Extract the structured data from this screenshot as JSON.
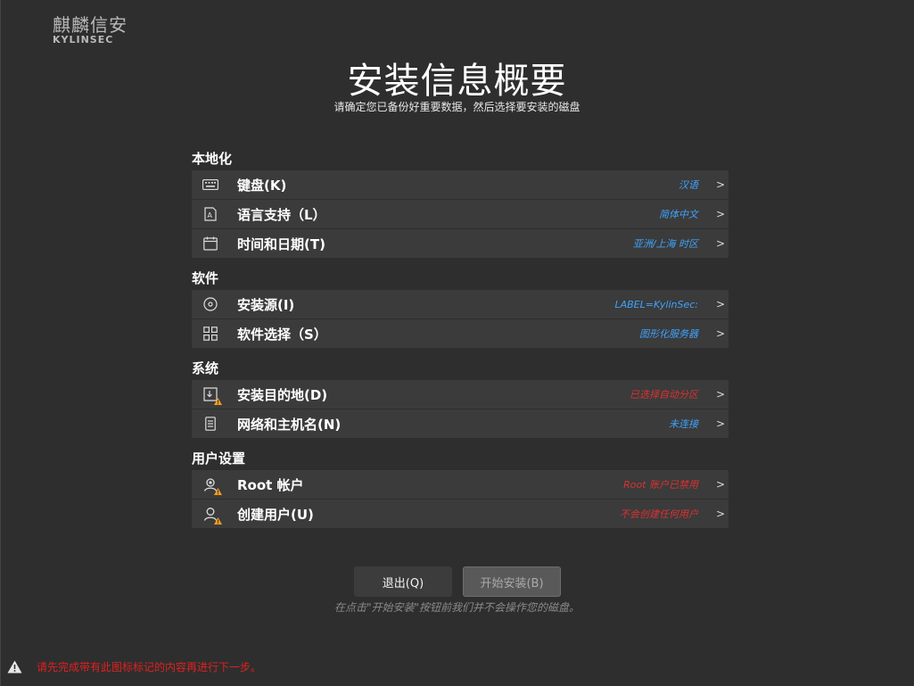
{
  "brand": {
    "name_cn": "麒麟信安",
    "name_en": "KYLINSEC"
  },
  "header": {
    "title": "安装信息概要",
    "subtitle": "请确定您已备份好重要数据，然后选择要安装的磁盘"
  },
  "sections": {
    "localization": {
      "title": "本地化",
      "items": [
        {
          "label": "键盘(K)",
          "status": "汉语",
          "icon": "keyboard-icon"
        },
        {
          "label": "语言支持（L）",
          "status": "简体中文",
          "icon": "language-icon"
        },
        {
          "label": "时间和日期(T)",
          "status": "亚洲/上海 时区",
          "icon": "calendar-icon"
        }
      ]
    },
    "software": {
      "title": "软件",
      "items": [
        {
          "label": "安装源(I)",
          "status": "LABEL=KylinSec:",
          "icon": "disc-icon"
        },
        {
          "label": "软件选择（S）",
          "status": "图形化服务器",
          "icon": "grid-icon"
        }
      ]
    },
    "system": {
      "title": "系统",
      "items": [
        {
          "label": "安装目的地(D)",
          "status": "已选择自动分区",
          "icon": "disk-warning-icon"
        },
        {
          "label": "网络和主机名(N)",
          "status": "未连接",
          "icon": "network-icon"
        }
      ]
    },
    "user": {
      "title": "用户设置",
      "items": [
        {
          "label": "Root 帐户",
          "status": "Root 账户已禁用",
          "icon": "root-user-warning-icon"
        },
        {
          "label": "创建用户(U)",
          "status": "不会创建任何用户",
          "icon": "user-warning-icon"
        }
      ]
    }
  },
  "chevron": ">",
  "buttons": {
    "quit": "退出(Q)",
    "begin_install": "开始安装(B)"
  },
  "hint": "在点击\"开始安装\"按钮前我们并不会操作您的磁盘。",
  "footer": {
    "warning": "请先完成带有此图标标记的内容再进行下一步。"
  },
  "colors": {
    "background": "#2e2e2e",
    "row": "#3b3b3b",
    "status_blue": "#3fa3ff",
    "status_red": "#d93232",
    "warning_orange": "#f29c1f"
  }
}
